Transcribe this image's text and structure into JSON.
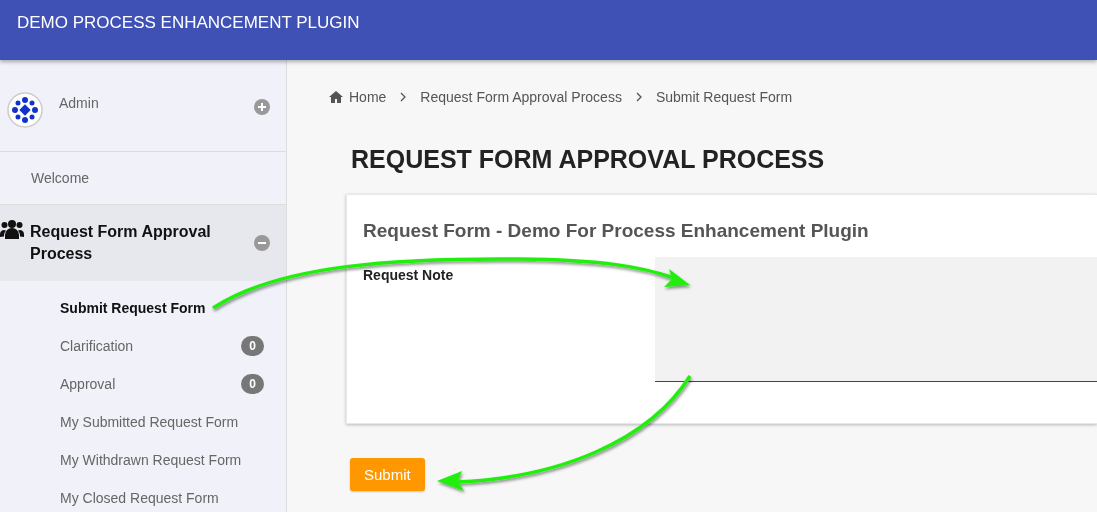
{
  "header": {
    "title": "DEMO PROCESS ENHANCEMENT PLUGIN"
  },
  "sidebar": {
    "profile": {
      "name": "Admin",
      "expanded": false
    },
    "items": [
      {
        "kind": "link",
        "label": "Welcome"
      },
      {
        "kind": "group",
        "label": "Request Form Approval Process",
        "expanded": true,
        "children": [
          {
            "label": "Submit Request Form",
            "selected": true
          },
          {
            "label": "Clarification",
            "selected": false,
            "badge": "0"
          },
          {
            "label": "Approval",
            "selected": false,
            "badge": "0"
          },
          {
            "label": "My Submitted Request Form",
            "selected": false
          },
          {
            "label": "My Withdrawn Request Form",
            "selected": false
          },
          {
            "label": "My Closed Request Form",
            "selected": false
          }
        ]
      }
    ]
  },
  "breadcrumb": [
    "Home",
    "Request Form Approval Process",
    "Submit Request Form"
  ],
  "page_title": "REQUEST FORM APPROVAL PROCESS",
  "form": {
    "title": "Request Form - Demo For Process Enhancement Plugin",
    "fields": [
      {
        "kind": "textarea",
        "label": "Request Note"
      }
    ],
    "submit": "Submit"
  }
}
